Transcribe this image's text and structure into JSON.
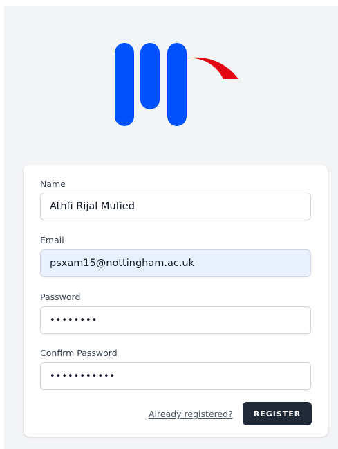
{
  "colors": {
    "logo_blue": "#0052ff",
    "logo_red": "#e30613",
    "button_bg": "#1f2937"
  },
  "form": {
    "name": {
      "label": "Name",
      "value": "Athfi Rijal Mufied"
    },
    "email": {
      "label": "Email",
      "value": "psxam15@nottingham.ac.uk"
    },
    "password": {
      "label": "Password",
      "value": "••••••••"
    },
    "confirm_password": {
      "label": "Confirm Password",
      "value": "•••••••••••"
    }
  },
  "actions": {
    "already_registered": "Already registered?",
    "register": "REGISTER"
  }
}
